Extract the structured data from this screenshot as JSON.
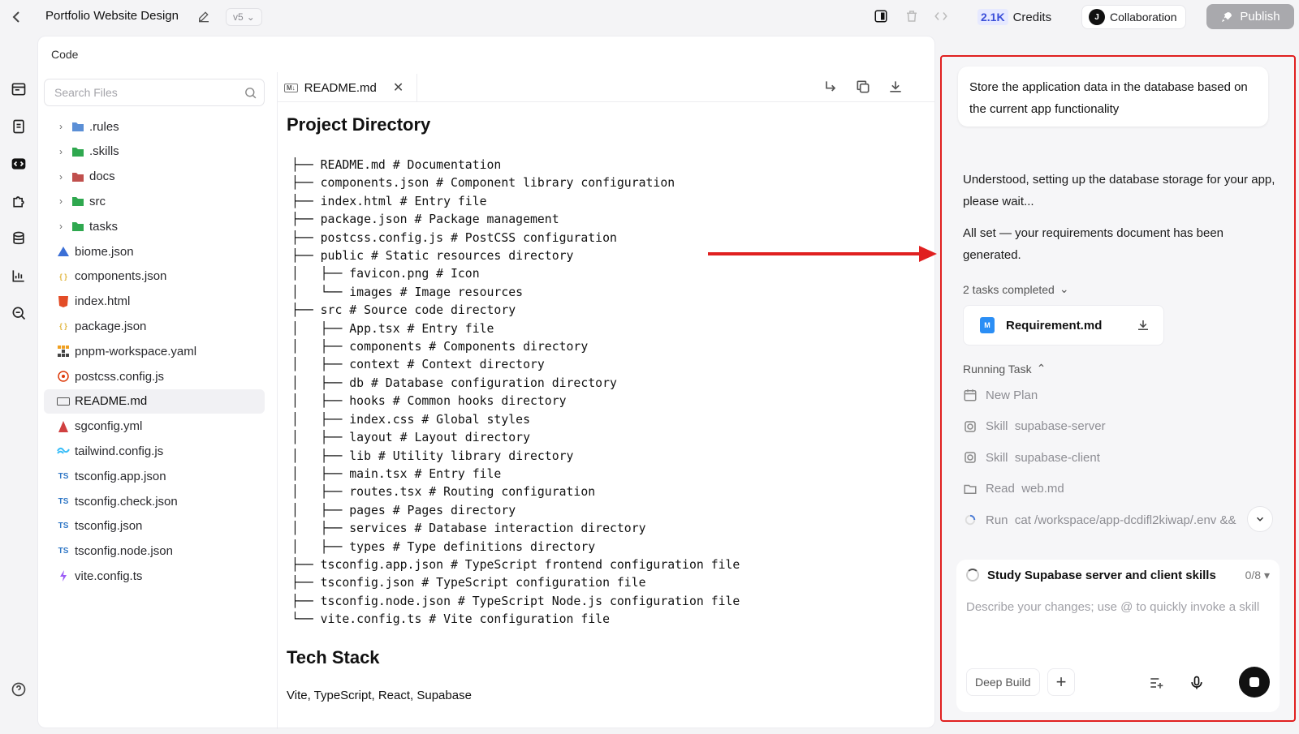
{
  "header": {
    "title": "Portfolio Website Design",
    "version": "v5",
    "credits_value": "2.1K",
    "credits_label": "Credits",
    "avatar_initial": "J",
    "collaboration": "Collaboration",
    "publish": "Publish"
  },
  "code_panel": {
    "label": "Code",
    "search_placeholder": "Search Files",
    "tree": [
      {
        "name": ".rules",
        "type": "folder",
        "icon": "folder-icon",
        "color": "#5b8fd6"
      },
      {
        "name": ".skills",
        "type": "folder",
        "icon": "folder-icon",
        "color": "#2fa84f"
      },
      {
        "name": "docs",
        "type": "folder",
        "icon": "folder-icon",
        "color": "#c0504d"
      },
      {
        "name": "src",
        "type": "folder",
        "icon": "folder-icon",
        "color": "#2fa84f"
      },
      {
        "name": "tasks",
        "type": "folder",
        "icon": "folder-icon",
        "color": "#2fa84f"
      },
      {
        "name": "biome.json",
        "type": "file",
        "icon": "biome-icon",
        "color": "#3b6fd6"
      },
      {
        "name": "components.json",
        "type": "file",
        "icon": "json-icon",
        "color": "#e0b43a"
      },
      {
        "name": "index.html",
        "type": "file",
        "icon": "html-icon",
        "color": "#e34c26"
      },
      {
        "name": "package.json",
        "type": "file",
        "icon": "json-icon",
        "color": "#e0b43a"
      },
      {
        "name": "pnpm-workspace.yaml",
        "type": "file",
        "icon": "pnpm-icon",
        "color": "#f0a020"
      },
      {
        "name": "postcss.config.js",
        "type": "file",
        "icon": "postcss-icon",
        "color": "#dd3a0a"
      },
      {
        "name": "README.md",
        "type": "file",
        "icon": "markdown-icon",
        "color": "#555555"
      },
      {
        "name": "sgconfig.yml",
        "type": "file",
        "icon": "yaml-icon",
        "color": "#d04040"
      },
      {
        "name": "tailwind.config.js",
        "type": "file",
        "icon": "tailwind-icon",
        "color": "#38bdf8"
      },
      {
        "name": "tsconfig.app.json",
        "type": "file",
        "icon": "ts-icon",
        "color": "#3178c6"
      },
      {
        "name": "tsconfig.check.json",
        "type": "file",
        "icon": "ts-icon",
        "color": "#3178c6"
      },
      {
        "name": "tsconfig.json",
        "type": "file",
        "icon": "ts-icon",
        "color": "#3178c6"
      },
      {
        "name": "tsconfig.node.json",
        "type": "file",
        "icon": "ts-icon",
        "color": "#3178c6"
      },
      {
        "name": "vite.config.ts",
        "type": "file",
        "icon": "vite-icon",
        "color": "#9b5cf6"
      }
    ],
    "active_file": "README.md"
  },
  "editor": {
    "tab_badge": "M↓",
    "tab_label": "README.md",
    "heading_1": "Project Directory",
    "directory_lines": [
      "├── README.md # Documentation",
      "├── components.json # Component library configuration",
      "├── index.html # Entry file",
      "├── package.json # Package management",
      "├── postcss.config.js # PostCSS configuration",
      "├── public # Static resources directory",
      "│   ├── favicon.png # Icon",
      "│   └── images # Image resources",
      "├── src # Source code directory",
      "│   ├── App.tsx # Entry file",
      "│   ├── components # Components directory",
      "│   ├── context # Context directory",
      "│   ├── db # Database configuration directory",
      "│   ├── hooks # Common hooks directory",
      "│   ├── index.css # Global styles",
      "│   ├── layout # Layout directory",
      "│   ├── lib # Utility library directory",
      "│   ├── main.tsx # Entry file",
      "│   ├── routes.tsx # Routing configuration",
      "│   ├── pages # Pages directory",
      "│   ├── services # Database interaction directory",
      "│   ├── types # Type definitions directory",
      "├── tsconfig.app.json # TypeScript frontend configuration file",
      "├── tsconfig.json # TypeScript configuration file",
      "├── tsconfig.node.json # TypeScript Node.js configuration file",
      "└── vite.config.ts # Vite configuration file"
    ],
    "heading_2": "Tech Stack",
    "tech_stack": "Vite, TypeScript, React, Supabase"
  },
  "chat": {
    "user_message": "Store the application data in the database based on the current app functionality",
    "reply_1": "Understood, setting up the database storage for your app, please wait...",
    "reply_2": "All set — your requirements document has been generated.",
    "tasks_completed": "2 tasks completed",
    "file_badge": "M",
    "file_card": "Requirement.md",
    "running_task": "Running Task",
    "steps": [
      {
        "icon": "calendar-icon",
        "label": "New Plan"
      },
      {
        "icon": "skill-icon",
        "label": "Skill  supabase-server"
      },
      {
        "icon": "skill-icon",
        "label": "Skill  supabase-client"
      },
      {
        "icon": "folder-outline-icon",
        "label": "Read  web.md"
      },
      {
        "icon": "spinner-icon",
        "label": "Run  cat /workspace/app-dcdifl2kiwap/.env &&"
      }
    ],
    "study_title": "Study Supabase server and client skills",
    "study_count": "0/8",
    "composer_placeholder": "Describe your changes; use @ to quickly invoke a skill",
    "deep_build": "Deep Build"
  },
  "colors": {
    "accent_red": "#e02020",
    "credits_blue": "#3b4fd9"
  }
}
